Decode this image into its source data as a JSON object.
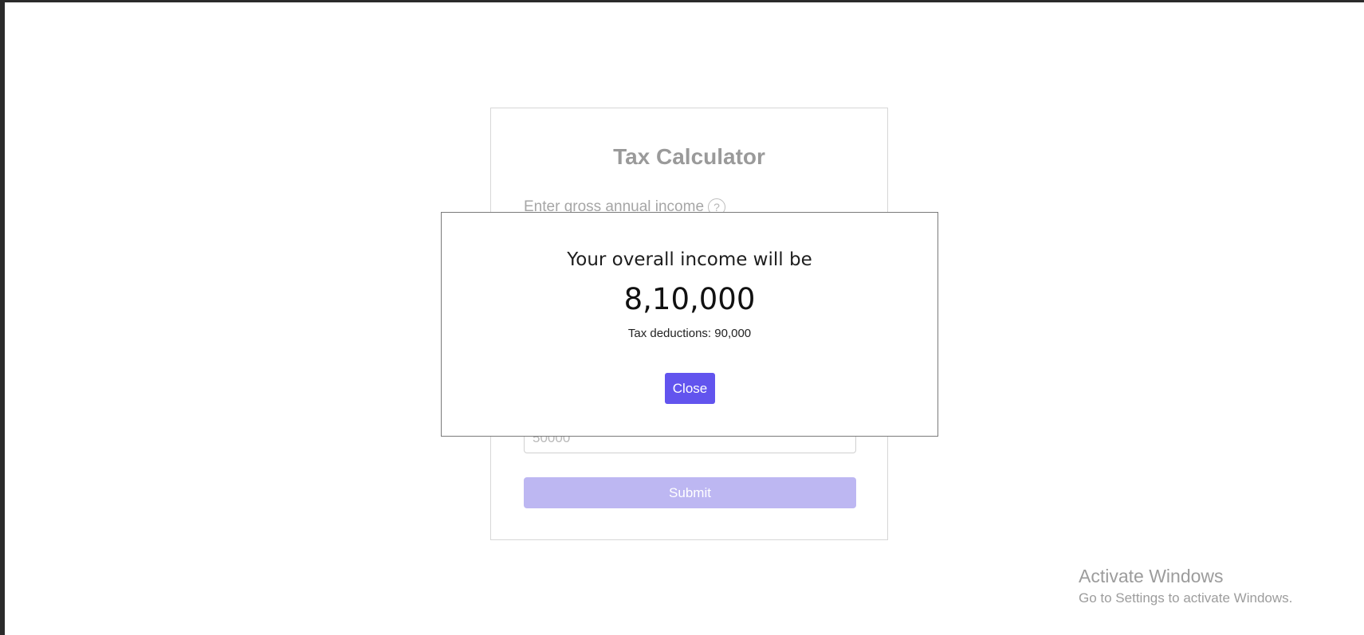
{
  "app": {
    "title": "Tax Calculator"
  },
  "form": {
    "income_label": "Enter gross annual income",
    "help_icon_glyph": "?",
    "partial_input_value": "50000",
    "submit_label": "Submit",
    "submit_color": "#bdb7f2"
  },
  "modal": {
    "heading": "Your overall income will be",
    "amount": "8,10,000",
    "deductions": "Tax deductions: 90,000",
    "close_label": "Close",
    "close_color": "#6254ee"
  },
  "os_watermark": {
    "title": "Activate Windows",
    "subtitle": "Go to Settings to activate Windows."
  }
}
